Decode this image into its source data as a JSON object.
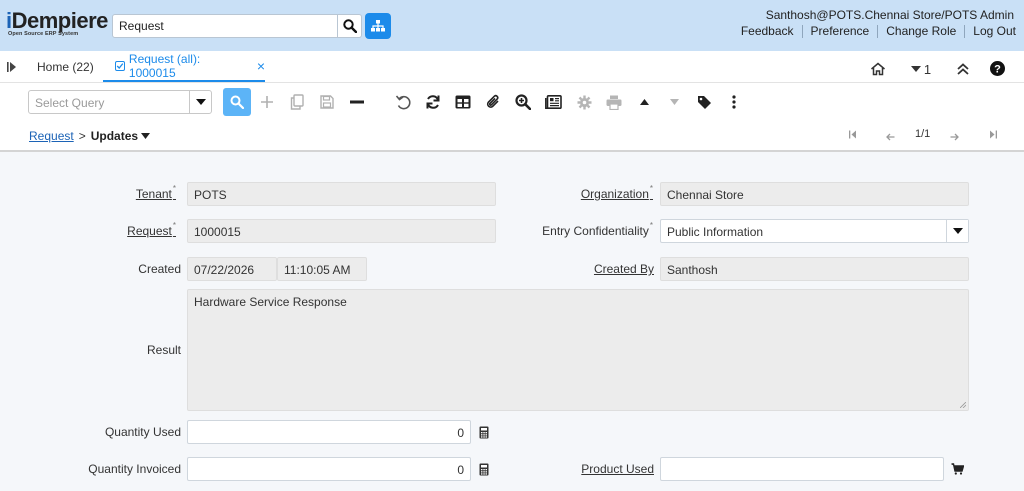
{
  "app": {
    "logo_text": "iDempiere",
    "logo_tagline": "Open Source ERP System"
  },
  "header": {
    "search_value": "Request",
    "user": "Santhosh@POTS.Chennai Store/POTS Admin",
    "links": [
      "Feedback",
      "Preference",
      "Change Role",
      "Log Out"
    ]
  },
  "tabs": {
    "home": "Home (22)",
    "active": "Request (all): 1000015",
    "close": "×"
  },
  "right_tools": {
    "counter": "1"
  },
  "toolbar": {
    "query_placeholder": "Select Query",
    "icons": [
      "find-icon",
      "new-record-icon",
      "copy-icon",
      "save-icon",
      "delete-icon",
      "undo-icon",
      "refresh-icon",
      "grid-toggle-icon",
      "attachment-icon",
      "zoom-across-icon",
      "report-icon",
      "process-icon",
      "print-icon",
      "previous-icon",
      "next-icon",
      "tag-icon",
      "more-icon"
    ]
  },
  "breadcrumb": {
    "parent": "Request",
    "sep": ">",
    "current": "Updates"
  },
  "record_nav": {
    "count": "1/1"
  },
  "form": {
    "tenant": {
      "label": "Tenant",
      "value": "POTS"
    },
    "organization": {
      "label": "Organization",
      "value": "Chennai Store"
    },
    "request": {
      "label": "Request",
      "value": "1000015"
    },
    "entry_confidentiality": {
      "label": "Entry Confidentiality",
      "value": "Public Information"
    },
    "created": {
      "label": "Created",
      "date": "07/22/2026",
      "time": "11:10:05 AM"
    },
    "created_by": {
      "label": "Created By",
      "value": "Santhosh"
    },
    "result": {
      "label": "Result",
      "value": "Hardware Service Response"
    },
    "quantity_used": {
      "label": "Quantity Used",
      "value": "0"
    },
    "quantity_invoiced": {
      "label": "Quantity Invoiced",
      "value": "0"
    },
    "product_used": {
      "label": "Product Used",
      "value": ""
    },
    "mandatory_mark": "*"
  },
  "colors": {
    "header_bg": "#c9e0f6",
    "accent": "#1c8bea",
    "find_button": "#5cb4f7",
    "readonly_field": "#ececec"
  }
}
